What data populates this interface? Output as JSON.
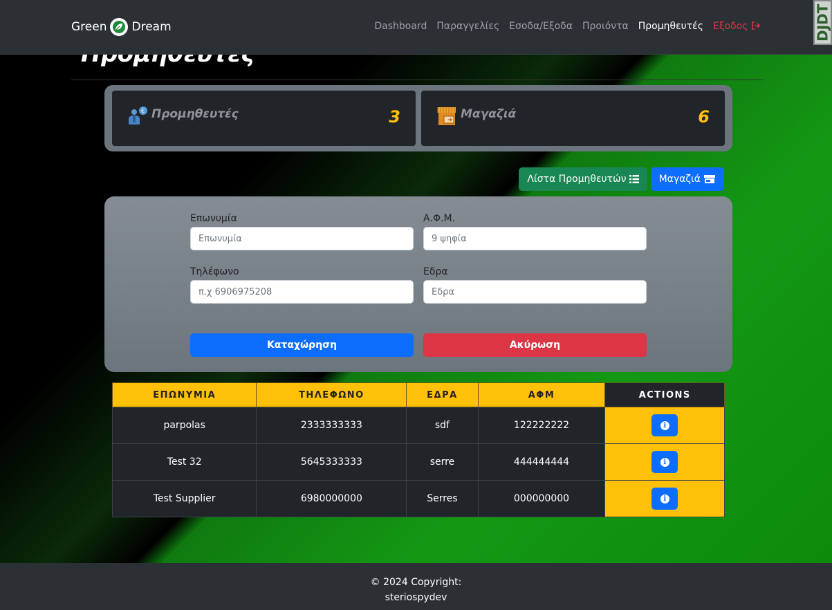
{
  "brand": {
    "left": "Green",
    "right": "Dream"
  },
  "nav": {
    "items": [
      {
        "label": "Dashboard"
      },
      {
        "label": "Παραγγελίες"
      },
      {
        "label": "Εσοδα/Εξοδα"
      },
      {
        "label": "Προιόντα"
      },
      {
        "label": "Προμηθευτές"
      }
    ],
    "logout": "Εξοδος"
  },
  "djdt": "DJDT",
  "page": {
    "title": "Προμηθευτές"
  },
  "stats": {
    "suppliers": {
      "label": "Προμηθευτές",
      "value": "3",
      "icon": "supplier-icon"
    },
    "stores": {
      "label": "Μαγαζιά",
      "value": "6",
      "icon": "store-icon"
    }
  },
  "actions": {
    "supplier_list": "Λίστα Προμηθευτών",
    "stores": "Μαγαζιά"
  },
  "form": {
    "name": {
      "label": "Επωνυμία",
      "placeholder": "Επωνυμία"
    },
    "afm": {
      "label": "Α.Φ.Μ.",
      "placeholder": "9 ψηφία"
    },
    "phone": {
      "label": "Τηλέφωνο",
      "placeholder": "π.χ 6906975208"
    },
    "seat": {
      "label": "Εδρα",
      "placeholder": "Εδρα"
    },
    "submit": "Καταχώρηση",
    "cancel": "Ακύρωση"
  },
  "table": {
    "headers": [
      "ΕΠΩΝΥΜΙΑ",
      "ΤΗΛΕΦΩΝΟ",
      "ΕΔΡΑ",
      "ΑΦΜ",
      "ACTIONS"
    ],
    "rows": [
      [
        "parpolas",
        "2333333333",
        "sdf",
        "122222222"
      ],
      [
        "Test 32",
        "5645333333",
        "serre",
        "444444444"
      ],
      [
        "Test Supplier",
        "6980000000",
        "Serres",
        "000000000"
      ]
    ]
  },
  "footer": {
    "line1": "© 2024 Copyright:",
    "line2": "steriospydev"
  },
  "colors": {
    "accent": "#ffc107",
    "primary": "#0d6efd",
    "danger": "#dc3545",
    "success": "#198754"
  }
}
